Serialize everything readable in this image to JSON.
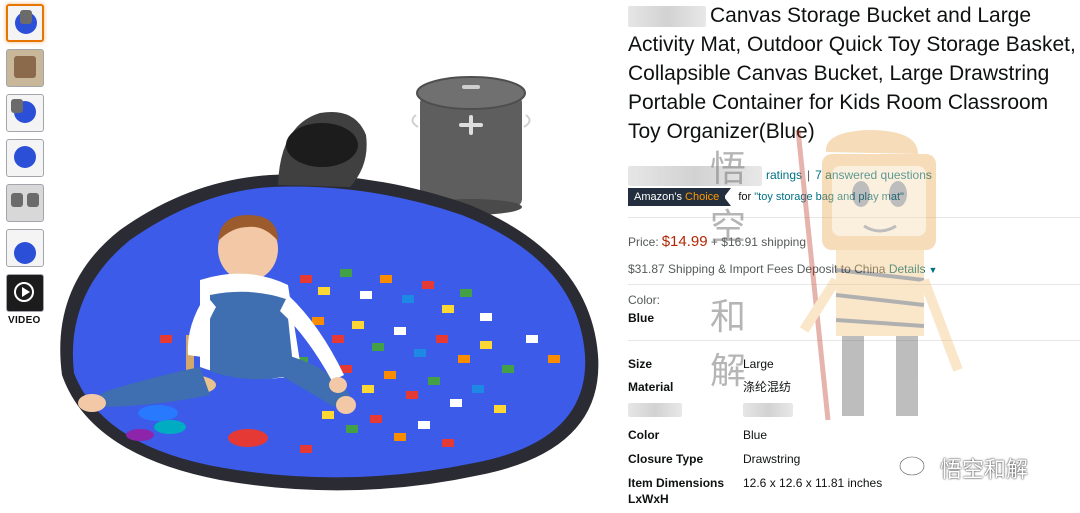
{
  "thumbnails": {
    "video_label": "VIDEO",
    "count": 7
  },
  "product": {
    "title": "Canvas Storage Bucket and Large Activity Mat, Outdoor Quick Toy Storage Basket, Collapsible Canvas Bucket, Large Drawstring Portable Container for Kids Room Classroom Toy Organizer(Blue)",
    "ratings_text": "ratings",
    "answered_text": "7 answered questions",
    "badge_prefix": "Amazon's",
    "badge_suffix": "Choice",
    "badge_for": "for",
    "badge_query": "\"toy storage bag and play mat\""
  },
  "price": {
    "label": "Price:",
    "amount": "$14.99",
    "shipping": "+ $16.91 shipping",
    "import_text": "$31.87 Shipping & Import Fees Deposit to China",
    "details_link": "Details"
  },
  "color": {
    "label": "Color:",
    "value": "Blue"
  },
  "specs": [
    {
      "key": "Size",
      "value": "Large"
    },
    {
      "key": "Material",
      "value": "涤纶混纺"
    },
    {
      "key": "",
      "value": ""
    },
    {
      "key": "Color",
      "value": "Blue"
    },
    {
      "key": "Closure Type",
      "value": "Drawstring"
    },
    {
      "key": "Item Dimensions LxWxH",
      "value": "12.6 x 12.6 x 11.81 inches"
    }
  ],
  "watermark": {
    "text": "悟空和解",
    "vertical_chars": [
      "悟",
      "空",
      "和",
      "解"
    ]
  },
  "colors": {
    "link": "#007185",
    "price": "#B12704",
    "badge_bg": "#232F3E",
    "badge_accent": "#FF9900",
    "active_thumb": "#E77600",
    "mat_blue": "#2C4FD8"
  }
}
